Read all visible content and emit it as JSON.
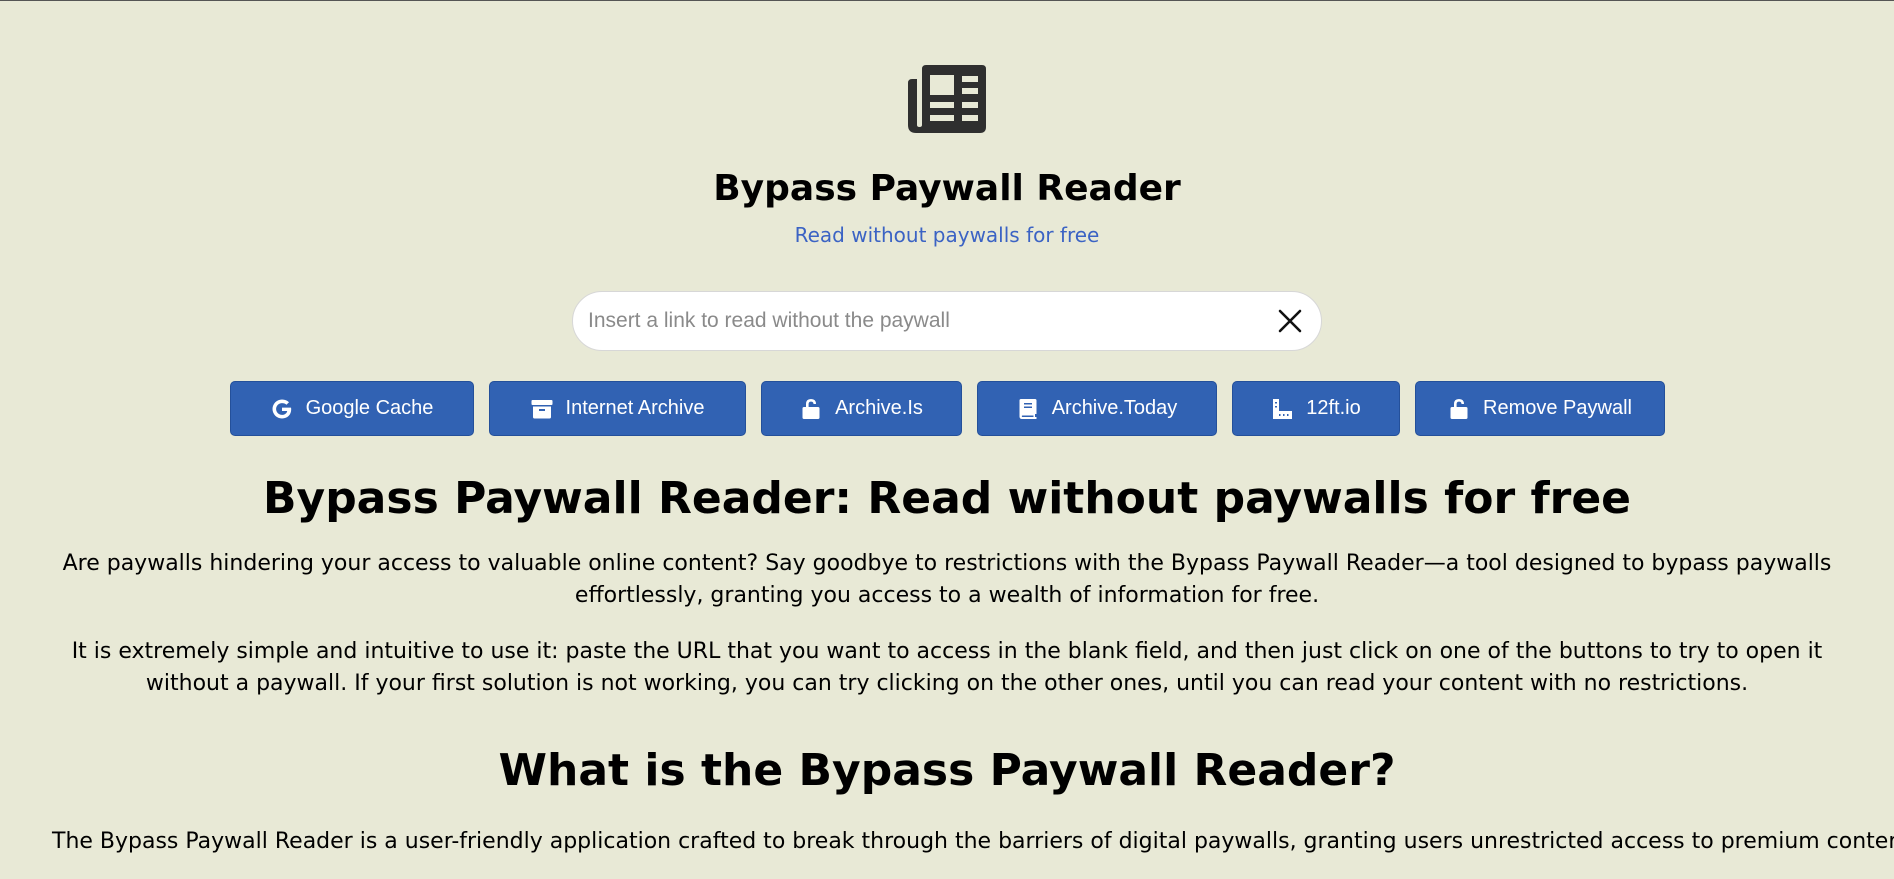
{
  "header": {
    "logo_icon": "newspaper-icon",
    "title": "Bypass Paywall Reader",
    "tagline": "Read without paywalls for free"
  },
  "search": {
    "value": "",
    "placeholder": "Insert a link to read without the paywall",
    "clear_icon": "close-icon"
  },
  "buttons": [
    {
      "label": "Google Cache",
      "icon": "google-icon"
    },
    {
      "label": "Internet Archive",
      "icon": "archive-box-icon"
    },
    {
      "label": "Archive.Is",
      "icon": "unlock-icon"
    },
    {
      "label": "Archive.Today",
      "icon": "book-icon"
    },
    {
      "label": "12ft.io",
      "icon": "ruler-icon"
    },
    {
      "label": "Remove Paywall",
      "icon": "unlock-icon"
    }
  ],
  "content": {
    "heading": "Bypass Paywall Reader: Read without paywalls for free",
    "intro": "Are paywalls hindering your access to valuable online content? Say goodbye to restrictions with the Bypass Paywall Reader—a tool designed to bypass paywalls effortlessly, granting you access to a wealth of information for free.",
    "usage": "It is extremely simple and intuitive to use it: paste the URL that you want to access in the blank field, and then just click on one of the buttons to try to open it without a paywall. If your first solution is not working, you can try clicking on the other ones, until you can read your content with no restrictions.",
    "subheading": "What is the Bypass Paywall Reader?",
    "description": "The Bypass Paywall Reader is a user-friendly application crafted to break through the barriers of digital paywalls, granting users unrestricted access to premium content"
  },
  "colors": {
    "background": "#e8e9d6",
    "accent": "#3162b3",
    "tagline": "#3b63c4"
  }
}
